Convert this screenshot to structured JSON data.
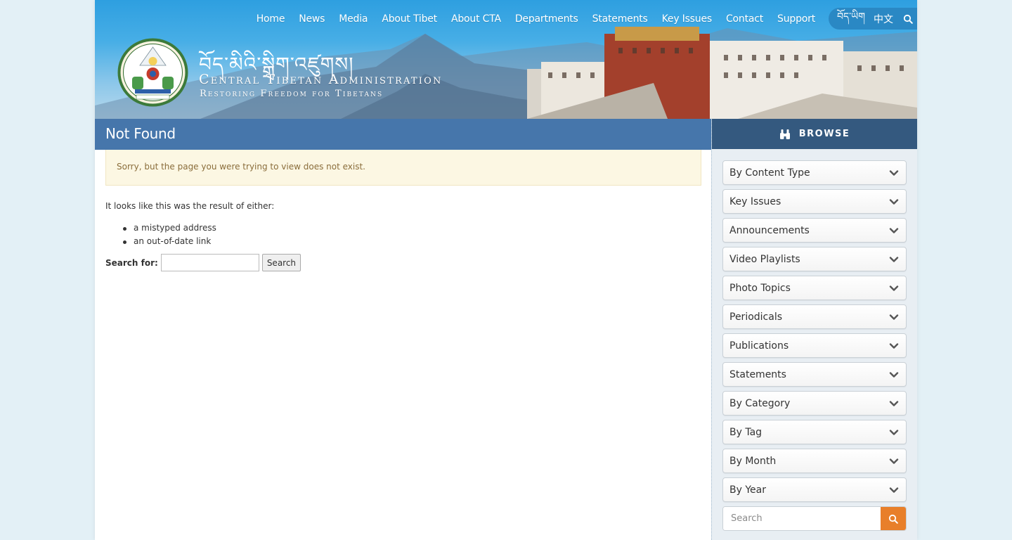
{
  "header": {
    "nav": [
      "Home",
      "News",
      "Media",
      "About Tibet",
      "About CTA",
      "Departments",
      "Statements",
      "Key Issues",
      "Contact",
      "Support"
    ],
    "languages": [
      "བོད་ཡིག",
      "中文"
    ],
    "brand_tibetan": "བོད་མིའི་སྒྲིག་འཛུགས།",
    "brand_title": "Central Tibetan Administration",
    "brand_subtitle": "Restoring Freedom for Tibetans",
    "logo_icon": "cta-emblem-icon",
    "search_icon": "search-icon"
  },
  "main": {
    "title": "Not Found",
    "notice": "Sorry, but the page you were trying to view does not exist.",
    "intro": "It looks like this was the result of either:",
    "reasons": [
      "a mistyped address",
      "an out-of-date link"
    ],
    "search_label": "Search for:",
    "search_value": "",
    "search_button": "Search"
  },
  "sidebar": {
    "browse_label": "BROWSE",
    "browse_icon": "binoculars-icon",
    "items": [
      {
        "label": "By Content Type"
      },
      {
        "label": "Key Issues"
      },
      {
        "label": "Announcements"
      },
      {
        "label": "Video Playlists"
      },
      {
        "label": "Photo Topics"
      },
      {
        "label": "Periodicals"
      },
      {
        "label": "Publications"
      },
      {
        "label": "Statements"
      },
      {
        "label": "By Category"
      },
      {
        "label": "By Tag"
      },
      {
        "label": "By Month"
      },
      {
        "label": "By Year"
      }
    ],
    "search_placeholder": "Search",
    "search_button_icon": "search-icon"
  },
  "colors": {
    "header_blue": "#2e9fe0",
    "title_bar": "#4676ab",
    "browse_bar": "#34597f",
    "notice_bg": "#fcf7e3",
    "notice_text": "#8a6d3b",
    "accent_orange": "#e87f2a",
    "page_bg": "#e3f0f6"
  }
}
